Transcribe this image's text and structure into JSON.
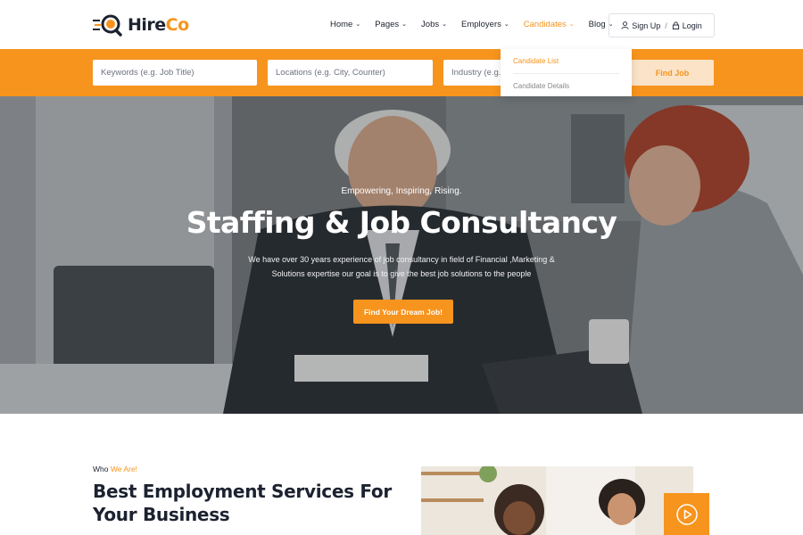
{
  "header": {
    "logo": {
      "text_main": "Hire",
      "text_accent": "Co",
      "icon": "magnifier-logo-icon"
    },
    "nav": [
      {
        "label": "Home",
        "active": false
      },
      {
        "label": "Pages",
        "active": false
      },
      {
        "label": "Jobs",
        "active": false
      },
      {
        "label": "Employers",
        "active": false
      },
      {
        "label": "Candidates",
        "active": true
      },
      {
        "label": "Blog",
        "active": false
      }
    ],
    "auth": {
      "signup_label": "Sign Up",
      "separator": "/",
      "login_label": "Login",
      "signup_icon": "user-icon",
      "login_icon": "lock-icon"
    }
  },
  "search": {
    "keywords_placeholder": "Keywords (e.g. Job Title)",
    "location_placeholder": "Locations (e.g. City, Counter)",
    "industry_placeholder": "Industry (e.g.",
    "button_label": "Find Job"
  },
  "candidates_dropdown": {
    "items": [
      "Candidate List",
      "Candidate Details"
    ]
  },
  "hero": {
    "tagline": "Empowering, Inspiring, Rising.",
    "title": "Staffing & Job Consultancy",
    "description_line1": "We have over 30 years experience of job consultancy in field of Financial ,Marketing &",
    "description_line2": "Solutions expertise our goal is to give the best job solutions to the people",
    "button_label": "Find Your Dream Job!"
  },
  "about": {
    "label_prefix": "Who ",
    "label_accent": "We Are!",
    "title": "Best Employment Services For Your Business",
    "play_icon": "play-icon"
  },
  "colors": {
    "accent": "#f7941d",
    "dark_text": "#1c2230",
    "white": "#ffffff"
  }
}
